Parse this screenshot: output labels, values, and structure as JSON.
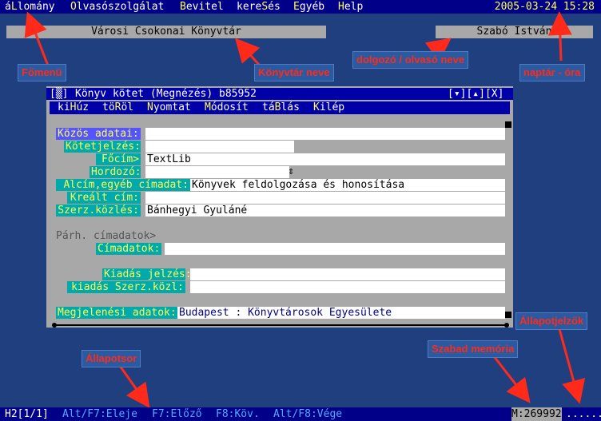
{
  "menubar": {
    "items": [
      {
        "pre": "á",
        "hk": "L",
        "post": "lomány"
      },
      {
        "pre": "",
        "hk": "O",
        "post": "lvasószolgálat"
      },
      {
        "pre": "",
        "hk": "B",
        "post": "evitel"
      },
      {
        "pre": "kere",
        "hk": "S",
        "post": "és"
      },
      {
        "pre": "",
        "hk": "E",
        "post": "gyéb"
      },
      {
        "pre": "",
        "hk": "H",
        "post": "elp"
      }
    ],
    "datetime": "2005-03-24 15:28"
  },
  "header": {
    "library": "Városi Csokonai Könyvtár",
    "user": "Szabó István"
  },
  "callouts": {
    "main_menu": "Főmenü",
    "library_name": "Könyvtár neve",
    "user_name": "dolgozó / olvasó neve",
    "calendar": "naptár - óra",
    "status_flags": "Állapotjelzők",
    "free_memory": "Szabad memória",
    "status_bar": "Állapotsor"
  },
  "window": {
    "sysmenu": "[▒]",
    "title": "Könyv kötet (Megnézés) b85952",
    "controls": "[▾][▴][X]",
    "menu": [
      {
        "pre": "ki",
        "hk": "H",
        "post": "úz"
      },
      {
        "pre": "tö",
        "hk": "R",
        "post": "öl"
      },
      {
        "pre": "",
        "hk": "N",
        "post": "yomtat"
      },
      {
        "pre": "",
        "hk": "M",
        "post": "ódosít"
      },
      {
        "pre": "tá",
        "hk": "B",
        "post": "lás"
      },
      {
        "pre": "",
        "hk": "K",
        "post": "ilép"
      }
    ]
  },
  "form": {
    "common_header": "Közös adatai:",
    "kotetjelzes_label": "Kötetjelzés:",
    "focim_label": "Főcím>",
    "focim_value": "TextLib",
    "hordozo_label": "Hordozó:",
    "alcim_label": "Alcím,egyéb címadat:",
    "alcim_value": "Könyvek feldolgozása és honosítása",
    "kreált_label": "Kreált cím:",
    "szerz_label": "Szerz.közlés:",
    "szerz_value": "Bánhegyi Gyuláné",
    "parh_label": "Párh. címadatok>",
    "cimadatok_label": "Címadatok:",
    "kiadas_label": "Kiadás jelzés:",
    "kiadas_szerz_label": "kiadás Szerz.közl:",
    "megjelenesi_label": "Megjelenési adatok:",
    "megjelenesi_value": "Budapest : Könyvtárosok Egyesülete"
  },
  "statusbar": {
    "mode": "H2[1/1]",
    "f7_alt": "Alt/F7:Eleje",
    "f7": "F7:Előző",
    "f8": "F8:Köv.",
    "f8_alt": "Alt/F8:Vége",
    "memory": "M:269992",
    "flags": "......"
  }
}
